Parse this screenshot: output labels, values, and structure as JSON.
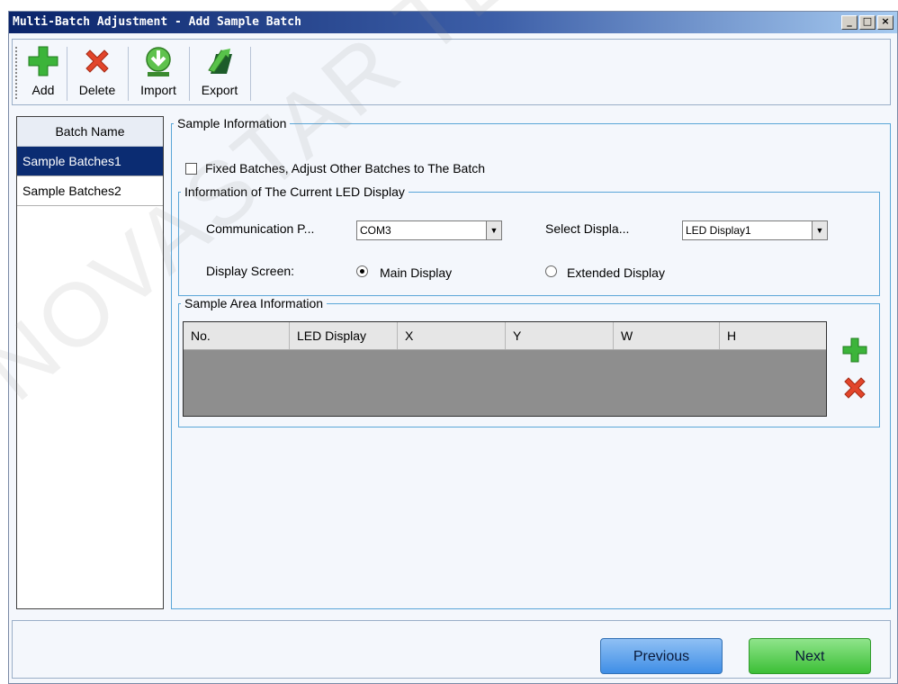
{
  "window": {
    "title": "Multi-Batch Adjustment - Add Sample Batch",
    "minimize_label": "_",
    "restore_label": "□",
    "close_label": "×"
  },
  "toolbar": {
    "add_label": "Add",
    "delete_label": "Delete",
    "import_label": "Import",
    "export_label": "Export"
  },
  "batches": {
    "header": "Batch Name",
    "items": [
      "Sample Batches1",
      "Sample Batches2"
    ],
    "selected_index": 0
  },
  "sample_info": {
    "legend": "Sample Information",
    "fixed_batch_label": "Fixed Batches, Adjust Other Batches to The Batch",
    "fixed_batch_checked": false
  },
  "led_display": {
    "legend": "Information of The Current LED Display",
    "comm_port_label": "Communication P...",
    "comm_port_value": "COM3",
    "select_display_label": "Select Displa...",
    "select_display_value": "LED Display1",
    "display_screen_label": "Display Screen:",
    "main_display_label": "Main Display",
    "extended_display_label": "Extended Display",
    "selected_screen": "Main Display"
  },
  "sample_area": {
    "legend": "Sample Area Information",
    "columns": [
      "No.",
      "LED Display",
      "X",
      "Y",
      "W",
      "H"
    ],
    "rows": []
  },
  "nav": {
    "previous_label": "Previous",
    "next_label": "Next"
  },
  "watermark": "NOVASTAR TECH CO., LTD",
  "colors": {
    "selection": "#0b2c72",
    "group_border": "#5aa6d8",
    "previous_button": "#3f8ee6",
    "next_button": "#3cbf36"
  }
}
